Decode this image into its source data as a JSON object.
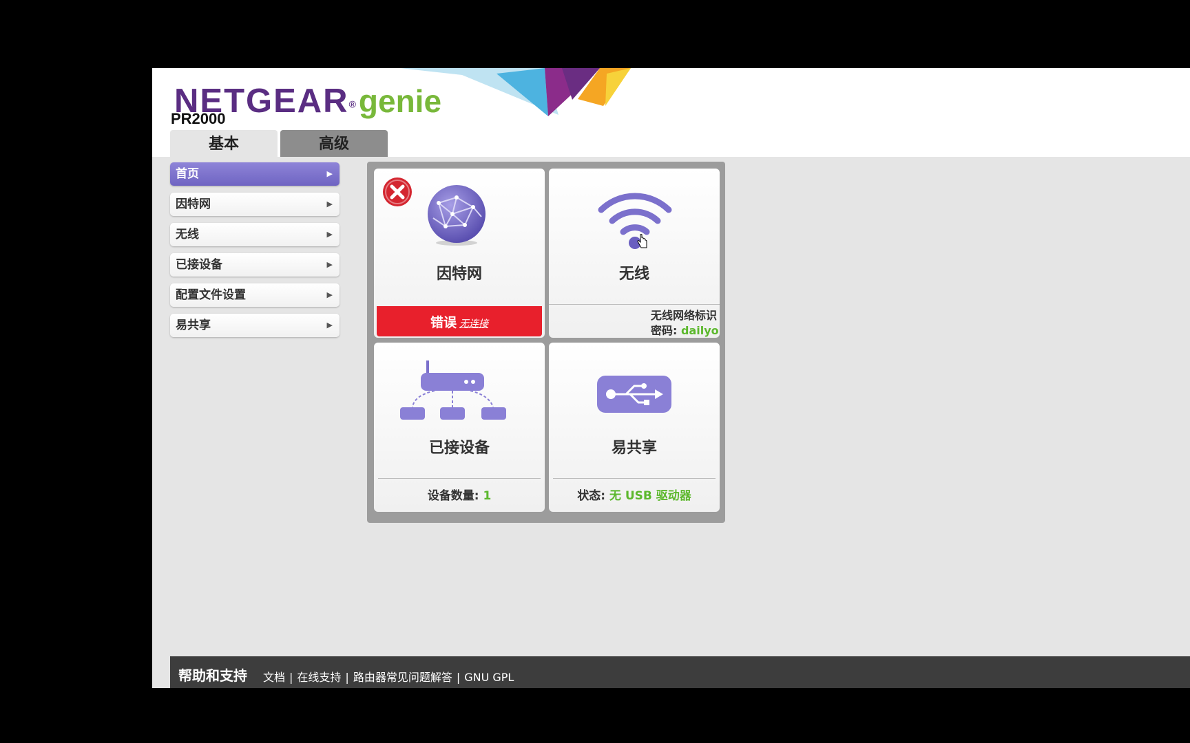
{
  "header": {
    "brand": "NETGEAR",
    "brand_mark": "®",
    "product": "genie",
    "model": "PR2000"
  },
  "tabs": [
    {
      "label": "基本",
      "active": true
    },
    {
      "label": "高级",
      "active": false
    }
  ],
  "sidebar": {
    "items": [
      {
        "label": "首页",
        "active": true
      },
      {
        "label": "因特网"
      },
      {
        "label": "无线"
      },
      {
        "label": "已接设备"
      },
      {
        "label": "配置文件设置"
      },
      {
        "label": "易共享"
      }
    ]
  },
  "tiles": {
    "internet": {
      "title": "因特网",
      "status": "错误",
      "status_detail": "无连接",
      "icon": "globe-icon"
    },
    "wireless": {
      "title": "无线",
      "ssid_label": "无线网络标识",
      "password_label": "密码:",
      "password_value": "dailyo",
      "icon": "wifi-icon"
    },
    "devices": {
      "title": "已接设备",
      "count_label": "设备数量:",
      "count_value": "1",
      "icon": "network-devices-icon"
    },
    "share": {
      "title": "易共享",
      "status_label": "状态:",
      "status_value": "无 USB 驱动器",
      "icon": "usb-icon"
    }
  },
  "footer": {
    "title": "帮助和支持",
    "links": [
      "文档",
      "在线支持",
      "路由器常见问题解答",
      "GNU GPL"
    ]
  },
  "colors": {
    "brand_purple": "#5a2d82",
    "genie_green": "#78b83a",
    "accent_purple": "#7b70cc",
    "error_red": "#e8202c",
    "status_green": "#5cb82d"
  }
}
